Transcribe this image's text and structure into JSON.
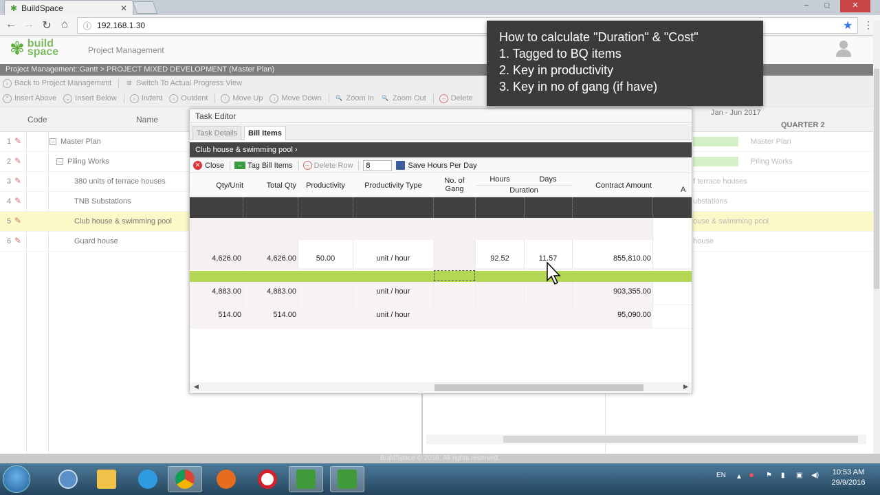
{
  "browser": {
    "tab_title": "BuildSpace",
    "url": "192.168.1.30",
    "window_controls": [
      "–",
      "□",
      "✕"
    ]
  },
  "app": {
    "brand_line1": "build",
    "brand_line2": "space",
    "title": "Project Management",
    "breadcrumb": "Project Management::Gantt > PROJECT MIXED DEVELOPMENT (Master Plan)",
    "footer": "BuildSpace © 2016. All rights reserved."
  },
  "toolbar1": {
    "back": "Back to Project Management",
    "switch": "Switch To Actual Progress View"
  },
  "toolbar2": {
    "insert_above": "Insert Above",
    "insert_below": "Insert Below",
    "indent": "Indent",
    "outdent": "Outdent",
    "move_up": "Move Up",
    "move_down": "Move Down",
    "zoom_in": "Zoom In",
    "zoom_out": "Zoom Out",
    "delete": "Delete"
  },
  "gantt": {
    "col_code": "Code",
    "col_name": "Name",
    "period": "Jan - Jun 2017",
    "quarter": "QUARTER 2",
    "rows": [
      {
        "num": "1",
        "name": "Master Plan",
        "right_name": "Master Plan"
      },
      {
        "num": "2",
        "name": "Piling Works",
        "right_name": "Piling Works"
      },
      {
        "num": "3",
        "name": "380 units of terrace houses",
        "right_name": "f terrace houses"
      },
      {
        "num": "4",
        "name": "TNB Substations",
        "right_name": "ubstations"
      },
      {
        "num": "5",
        "name": "Club house & swimming pool",
        "right_name": "ouse & swimming pool"
      },
      {
        "num": "6",
        "name": "Guard house",
        "right_name": "house"
      }
    ]
  },
  "editor": {
    "title": "Task Editor",
    "tab_details": "Task Details",
    "tab_bill": "Bill Items",
    "crumb": "Club house & swimming pool",
    "btn_close": "Close",
    "btn_tag": "Tag Bill Items",
    "btn_delete_row": "Delete Row",
    "hours_value": "8",
    "btn_save_hours": "Save Hours Per Day",
    "headers": {
      "qty_unit": "Qty/Unit",
      "total_qty": "Total Qty",
      "productivity": "Productivity",
      "productivity_type": "Productivity Type",
      "no_of_gang_1": "No. of",
      "no_of_gang_2": "Gang",
      "hours": "Hours",
      "days": "Days",
      "duration": "Duration",
      "contract_amount": "Contract Amount",
      "extra": "A"
    },
    "rows": [
      {
        "qty_unit": "4,626.00",
        "total_qty": "4,626.00",
        "productivity": "50.00",
        "productivity_type": "unit / hour",
        "hours": "92.52",
        "days": "11.57",
        "contract_amount": "855,810.00"
      },
      {
        "qty_unit": "4,883.00",
        "total_qty": "4,883.00",
        "productivity": "",
        "productivity_type": "unit / hour",
        "hours": "",
        "days": "",
        "contract_amount": "903,355.00"
      },
      {
        "qty_unit": "514.00",
        "total_qty": "514.00",
        "productivity": "",
        "productivity_type": "unit / hour",
        "hours": "",
        "days": "",
        "contract_amount": "95,090.00"
      }
    ]
  },
  "tooltip": {
    "line1": "How to calculate \"Duration\" & \"Cost\"",
    "line2": "1. Tagged to BQ items",
    "line3": "2. Key in productivity",
    "line4": "3. Key in no of gang (if have)"
  },
  "taskbar": {
    "lang": "EN",
    "time": "10:53 AM",
    "date": "29/9/2016"
  }
}
